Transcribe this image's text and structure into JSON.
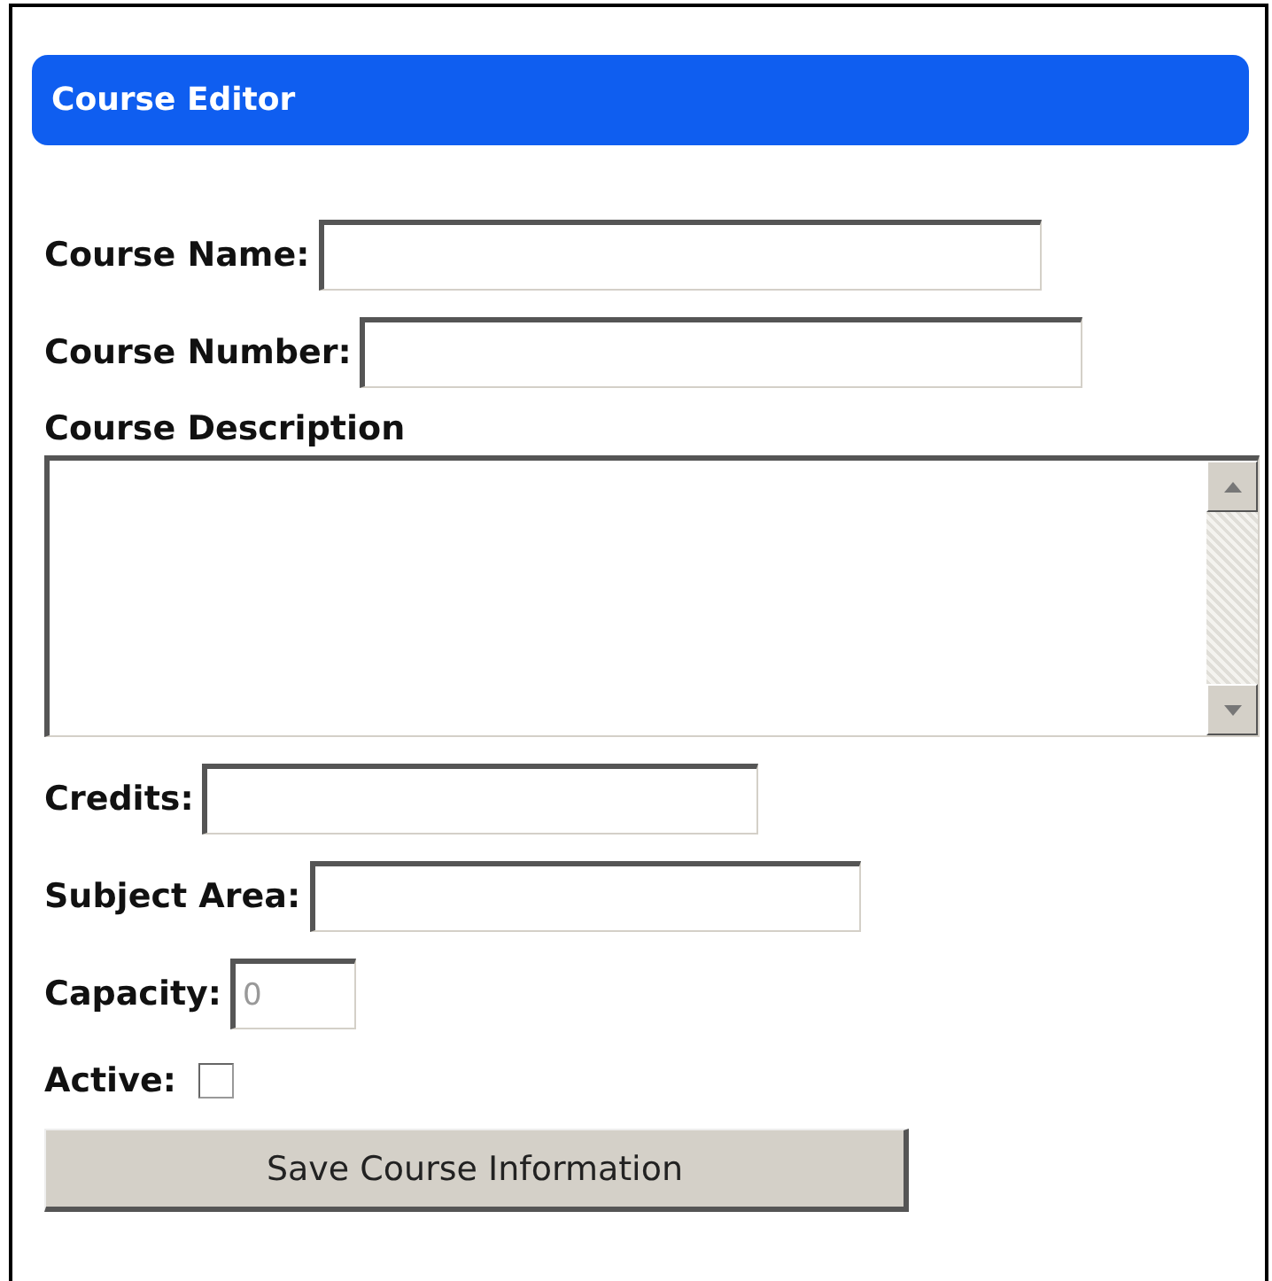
{
  "panel": {
    "title": "Course Editor"
  },
  "fields": [
    {
      "kind": "text",
      "label": "Course Name:"
    },
    {
      "kind": "text",
      "label": "Course Number:"
    },
    {
      "kind": "textarea",
      "label": "Course Description"
    },
    {
      "kind": "text",
      "label": "Credits:"
    },
    {
      "kind": "text",
      "label": "Subject Area:"
    },
    {
      "kind": "text",
      "label": "Capacity:",
      "placeholder": "0"
    },
    {
      "kind": "checkbox",
      "label": "Active:",
      "checked": false
    }
  ],
  "buttons": [
    "Save Course Information"
  ]
}
